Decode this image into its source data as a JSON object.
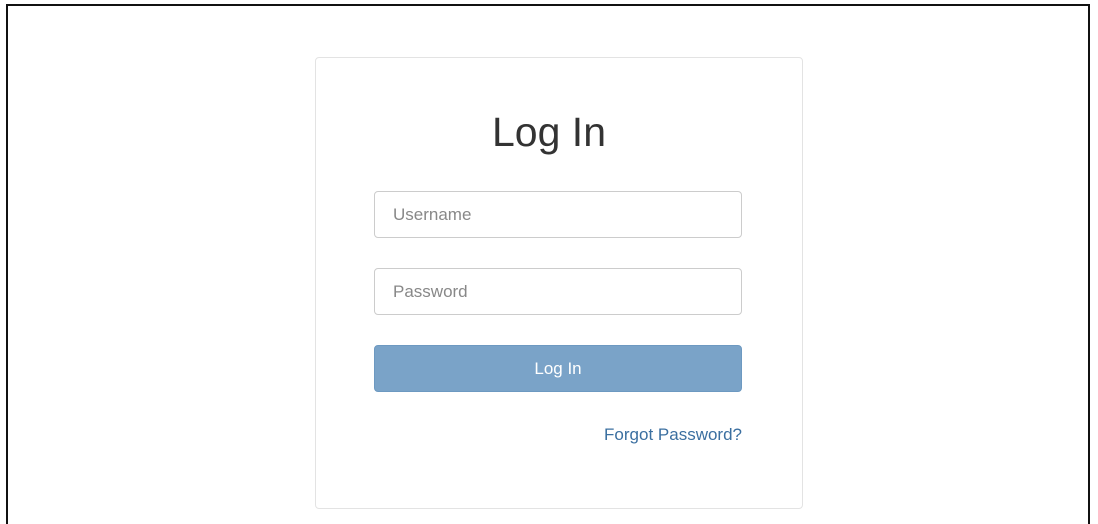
{
  "login": {
    "title": "Log In",
    "username_placeholder": "Username",
    "password_placeholder": "Password",
    "submit_label": "Log In",
    "forgot_link": "Forgot Password?"
  },
  "colors": {
    "button_bg": "#7aa3c8",
    "link": "#3b6fa0"
  }
}
